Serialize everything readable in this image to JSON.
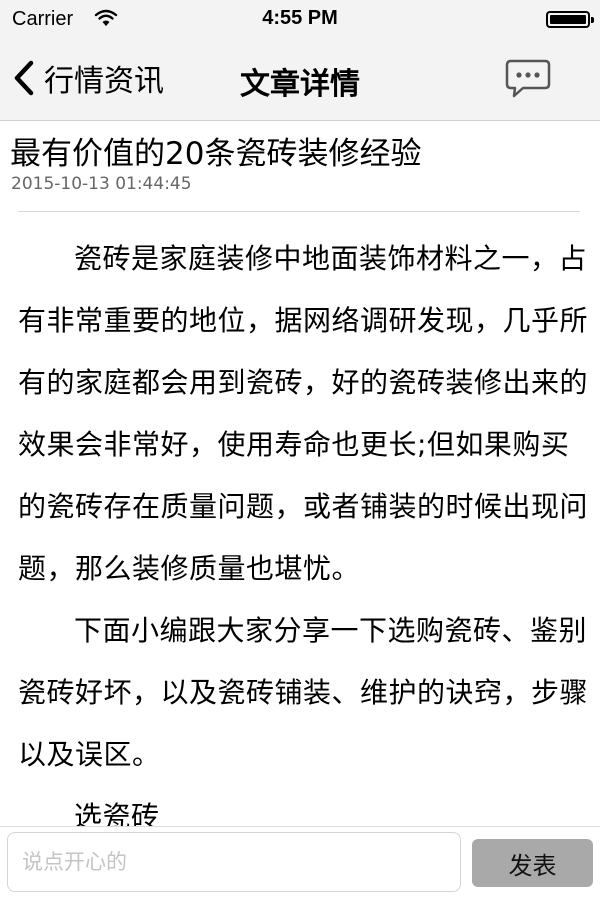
{
  "status_bar": {
    "carrier": "Carrier",
    "time": "4:55 PM",
    "wifi_icon": "wifi-icon",
    "battery_icon": "battery-icon"
  },
  "nav": {
    "back_label": "行情资讯",
    "back_icon": "chevron-left-icon",
    "title": "文章详情",
    "comment_icon": "chat-bubble-icon"
  },
  "article": {
    "title": "最有价值的20条瓷砖装修经验",
    "date": "2015-10-13 01:44:45",
    "paragraphs": [
      "瓷砖是家庭装修中地面装饰材料之一，占有非常重要的地位，据网络调研发现，几乎所有的家庭都会用到瓷砖，好的瓷砖装修出来的效果会非常好，使用寿命也更长;但如果购买的瓷砖存在质量问题，或者铺装的时候出现问题，那么装修质量也堪忧。",
      "下面小编跟大家分享一下选购瓷砖、鉴别瓷砖好坏，以及瓷砖铺装、维护的诀窍，步骤以及误区。",
      "选瓷砖"
    ]
  },
  "comment_bar": {
    "placeholder": "说点开心的",
    "value": "",
    "send_label": "发表"
  },
  "colors": {
    "bar_background": "#f3f3f3",
    "send_button": "#a9a9a9"
  }
}
